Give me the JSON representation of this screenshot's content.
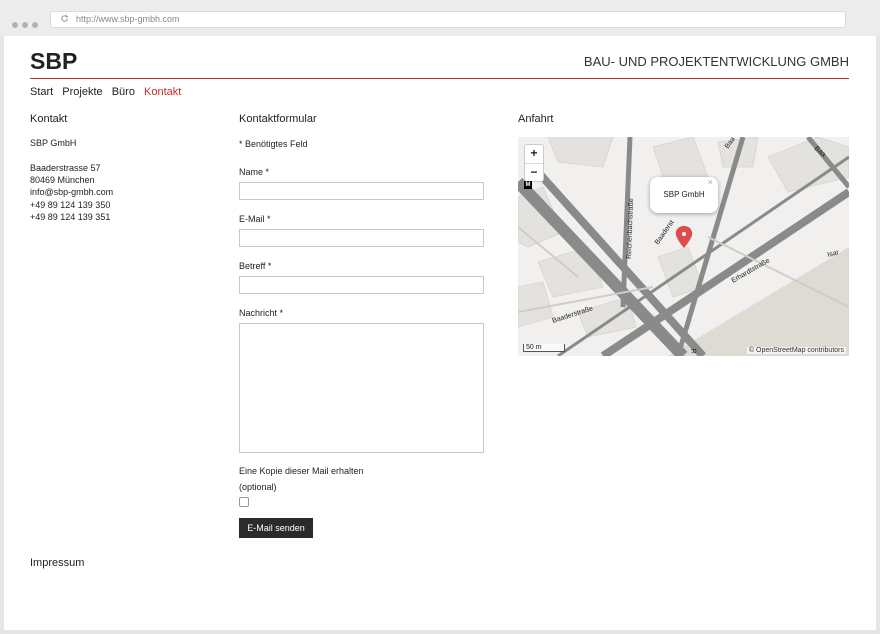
{
  "browser": {
    "url": "http://www.sbp-gmbh.com"
  },
  "header": {
    "logo": "SBP",
    "tagline": "BAU- UND PROJEKTENTWICKLUNG GMBH"
  },
  "nav": {
    "items": [
      {
        "label": "Start"
      },
      {
        "label": "Projekte"
      },
      {
        "label": "Büro"
      },
      {
        "label": "Kontakt"
      }
    ],
    "active_color": "#c62b2b"
  },
  "contact": {
    "heading": "Kontakt",
    "company": "SBP GmbH",
    "street": "Baaderstrasse 57",
    "city": "80469 München",
    "email": "info@sbp-gmbh.com",
    "phone1": "+49 89 124 139 350",
    "phone2": "+49 89 124 139 351"
  },
  "form": {
    "heading": "Kontaktformular",
    "required_note": "* Benötigtes Feld",
    "name_label": "Name *",
    "email_label": "E-Mail *",
    "subject_label": "Betreff *",
    "message_label": "Nachricht *",
    "copy_label": "Eine Kopie dieser Mail erhalten",
    "optional_label": "(optional)",
    "submit_label": "E-Mail senden"
  },
  "map": {
    "heading": "Anfahrt",
    "zoom_in": "+",
    "zoom_out": "−",
    "popup": "SBP GmbH",
    "popup_close": "×",
    "scale": "50 m",
    "attribution": "© OpenStreetMap contributors",
    "streets": [
      "Reichenbachstraße",
      "Baaderstraße",
      "Erhardtstraße",
      "Baaderst",
      "Isar",
      "Baa",
      "M",
      "R"
    ]
  },
  "footer": {
    "impressum": "Impressum"
  }
}
